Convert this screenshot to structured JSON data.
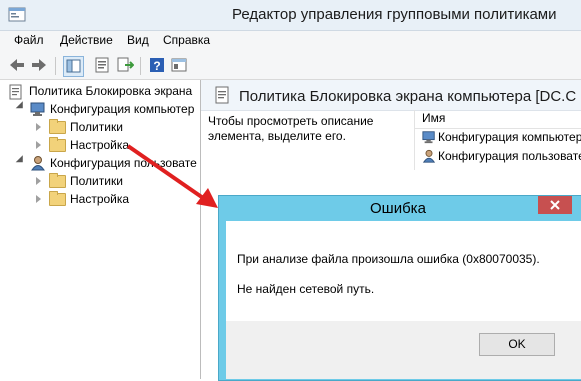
{
  "window": {
    "title": "Редактор управления групповыми политиками"
  },
  "menu": {
    "items": [
      "Файл",
      "Действие",
      "Вид",
      "Справка"
    ]
  },
  "tree": {
    "root": "Политика Блокировка экрана",
    "computer_config": "Конфигурация компьютер",
    "computer_policies": "Политики",
    "computer_settings": "Настройка",
    "user_config": "Конфигурация пользовате",
    "user_policies": "Политики",
    "user_settings": "Настройка"
  },
  "right_pane": {
    "title": "Политика Блокировка экрана компьютера  [DC.C",
    "description": "Чтобы просмотреть описание элемента, выделите его.",
    "column_name": "Имя",
    "items": [
      "Конфигурация компьютер",
      "Конфигурация пользовате"
    ]
  },
  "dialog": {
    "title": "Ошибка",
    "message1": "При анализе файла произошла ошибка (0x80070035).",
    "message2": "Не найден сетевой путь.",
    "ok_label": "OK"
  },
  "colors": {
    "dialog_frame": "#6ecbe8",
    "close_button": "#c75050",
    "arrow": "#e02020"
  }
}
